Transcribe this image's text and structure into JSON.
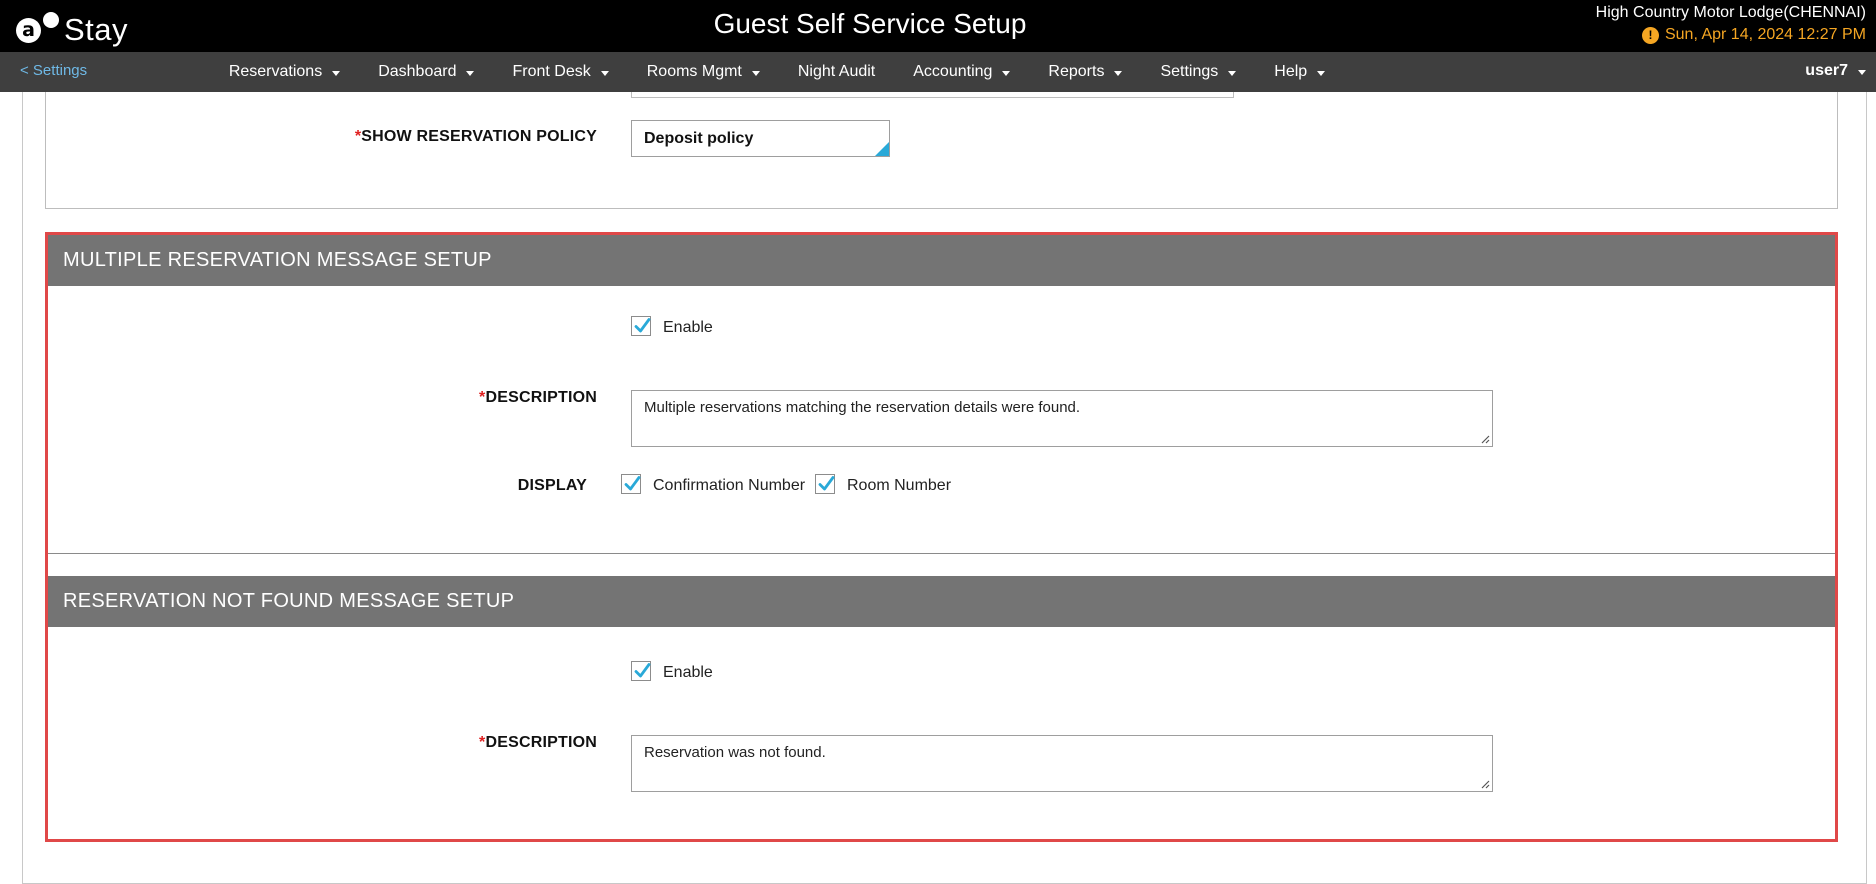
{
  "header": {
    "logo_letter": "a",
    "logo_text": "Stay",
    "title": "Guest Self Service Setup",
    "hotel_name": "High Country Motor Lodge(CHENNAI)",
    "datetime": "Sun, Apr 14, 2024 12:27 PM",
    "alert_glyph": "!"
  },
  "nav": {
    "back_label": "< Settings",
    "items": [
      {
        "label": "Reservations",
        "dropdown": true
      },
      {
        "label": "Dashboard",
        "dropdown": true
      },
      {
        "label": "Front Desk",
        "dropdown": true
      },
      {
        "label": "Rooms Mgmt",
        "dropdown": true
      },
      {
        "label": "Night Audit",
        "dropdown": false
      },
      {
        "label": "Accounting",
        "dropdown": true
      },
      {
        "label": "Reports",
        "dropdown": true
      },
      {
        "label": "Settings",
        "dropdown": true
      },
      {
        "label": "Help",
        "dropdown": true
      }
    ],
    "user": "user7"
  },
  "reservation_policy": {
    "required_mark": "*",
    "label": "SHOW RESERVATION POLICY",
    "selected_value": "Deposit policy"
  },
  "multiple_reservation": {
    "heading": "MULTIPLE RESERVATION MESSAGE SETUP",
    "enable_label": "Enable",
    "enabled": true,
    "description_label": "DESCRIPTION",
    "required_mark": "*",
    "description_value": "Multiple reservations matching the reservation details were found.",
    "display_label": "DISPLAY",
    "display_options": [
      {
        "label": "Confirmation Number",
        "checked": true
      },
      {
        "label": "Room Number",
        "checked": true
      }
    ]
  },
  "not_found": {
    "heading": "RESERVATION NOT FOUND MESSAGE SETUP",
    "enable_label": "Enable",
    "enabled": true,
    "description_label": "DESCRIPTION",
    "required_mark": "*",
    "description_value": "Reservation was not found."
  },
  "colors": {
    "accent": "#29a9d8",
    "highlight_border": "#e04848",
    "section_header": "#747474",
    "date_text": "#f5a623",
    "required": "#e02020"
  }
}
